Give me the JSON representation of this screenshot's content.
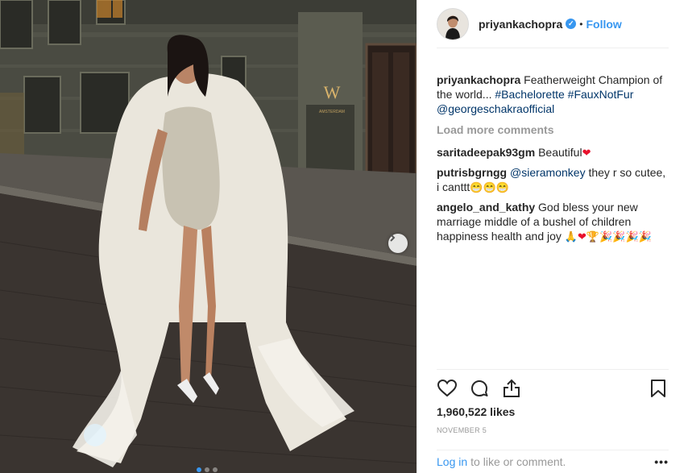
{
  "post": {
    "username": "priyankachopra",
    "follow_label": "Follow",
    "separator": "•",
    "caption": {
      "user": "priyankachopra",
      "text": "Featherweight Champion of the world...",
      "hashtags": [
        "#Bachelorette",
        "#FauxNotFur"
      ],
      "mention": "@georgeschakraofficial"
    },
    "load_more": "Load more comments",
    "comments": [
      {
        "user": "saritadeepak93gm",
        "text": "Beautiful",
        "emojis": [
          "❤"
        ]
      },
      {
        "user": "putrisbgrngg",
        "mention": "@sieramonkey",
        "text": "they r so cutee, i canttt",
        "emojis": [
          "😁",
          "😁",
          "😁"
        ]
      },
      {
        "user": "angelo_and_kathy",
        "text": "God bless your new marriage middle of a bushel of children happiness health and joy",
        "emojis": [
          "🙏",
          "❤",
          "🏆",
          "🎉",
          "🎉",
          "🎉",
          "🎉"
        ]
      }
    ],
    "likes": "1,960,522 likes",
    "date": "NOVEMBER 5",
    "login_link": "Log in",
    "login_text": "to like or comment.",
    "more_label": "•••",
    "hotel_sign": "W",
    "hotel_text": "AMSTERDAM"
  },
  "icons": {
    "like": "heart-outline-icon",
    "comment": "comment-bubble-icon",
    "share": "share-upload-icon",
    "save": "bookmark-icon",
    "next": "chevron-right-icon",
    "verified": "verified-badge-icon"
  },
  "colors": {
    "accent": "#3897f0",
    "text": "#262626",
    "muted": "#999999",
    "link": "#003569",
    "heart": "#e8102c"
  },
  "carousel": {
    "count": 3,
    "active": 1
  }
}
